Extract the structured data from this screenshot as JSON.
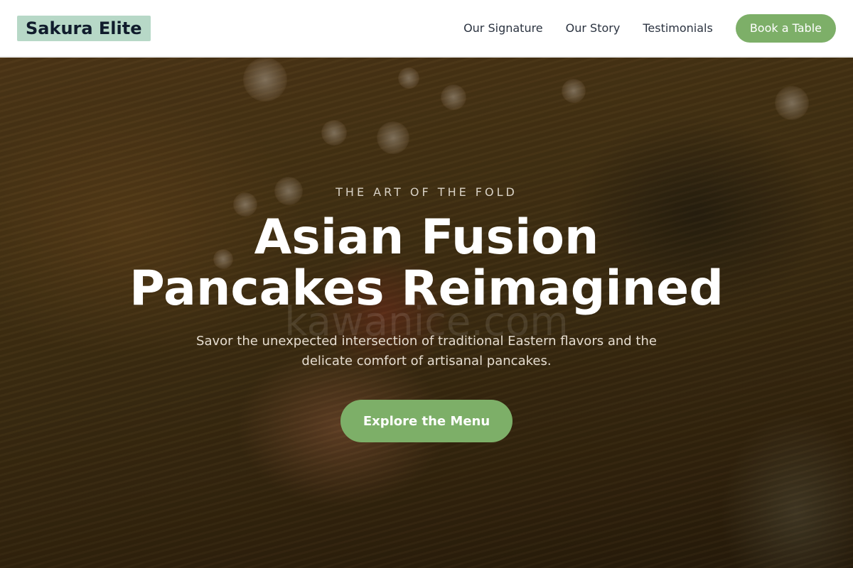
{
  "header": {
    "brand": "Sakura Elite",
    "nav": [
      {
        "label": "Our Signature"
      },
      {
        "label": "Our Story"
      },
      {
        "label": "Testimonials"
      }
    ],
    "cta_label": "Book a Table"
  },
  "hero": {
    "eyebrow": "THE ART OF THE FOLD",
    "title_line1": "Asian Fusion",
    "title_line2": "Pancakes Reimagined",
    "watermark": "kawanice.com",
    "subtitle_line1": "Savor the unexpected intersection of traditional Eastern flavors and the",
    "subtitle_line2": "delicate comfort of artisanal pancakes.",
    "cta_label": "Explore the Menu"
  },
  "colors": {
    "brand_badge": "#b7d8c7",
    "accent_green": "#7daf68",
    "nav_text": "#2b3340"
  }
}
